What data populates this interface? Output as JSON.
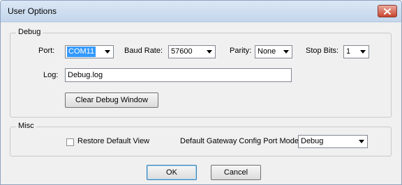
{
  "window": {
    "title": "User Options"
  },
  "debug": {
    "group_label": "Debug",
    "port": {
      "label": "Port:",
      "value": "COM11"
    },
    "baud_rate": {
      "label": "Baud Rate:",
      "value": "57600"
    },
    "parity": {
      "label": "Parity:",
      "value": "None"
    },
    "stop_bits": {
      "label": "Stop Bits:",
      "value": "1"
    },
    "log": {
      "label": "Log:",
      "value": "Debug.log"
    },
    "clear_button": "Clear Debug Window"
  },
  "misc": {
    "group_label": "Misc",
    "restore_default_view": {
      "label": "Restore Default View",
      "checked": false
    },
    "gateway_mode": {
      "label": "Default Gateway Config Port Mode:",
      "value": "Debug"
    }
  },
  "buttons": {
    "ok": "OK",
    "cancel": "Cancel"
  },
  "colors": {
    "selection": "#3399ff",
    "close_button": "#c8452f",
    "titlebar": "#c4d6ec"
  },
  "icons": {
    "close": "close-icon",
    "dropdown": "chevron-down-icon"
  }
}
